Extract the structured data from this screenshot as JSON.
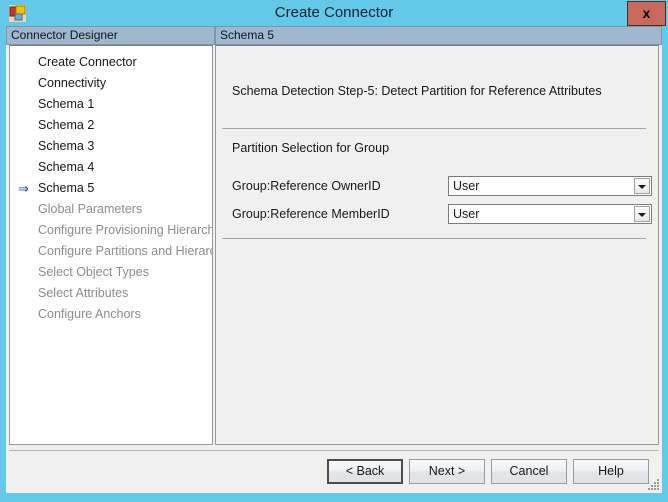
{
  "window": {
    "title": "Create Connector",
    "app_icon": "connector-app-icon",
    "close_label": "x"
  },
  "tabs": {
    "left": "Connector Designer",
    "right": "Schema 5"
  },
  "sidebar": {
    "items": [
      {
        "label": "Create Connector",
        "state": "enabled",
        "current": false
      },
      {
        "label": "Connectivity",
        "state": "enabled",
        "current": false
      },
      {
        "label": "Schema 1",
        "state": "enabled",
        "current": false
      },
      {
        "label": "Schema 2",
        "state": "enabled",
        "current": false
      },
      {
        "label": "Schema 3",
        "state": "enabled",
        "current": false
      },
      {
        "label": "Schema 4",
        "state": "enabled",
        "current": false
      },
      {
        "label": "Schema 5",
        "state": "enabled",
        "current": true,
        "marker": "⇒"
      },
      {
        "label": "Global Parameters",
        "state": "disabled",
        "current": false
      },
      {
        "label": "Configure Provisioning Hierarchy",
        "state": "disabled",
        "current": false
      },
      {
        "label": "Configure Partitions and Hierarchies",
        "state": "disabled",
        "current": false
      },
      {
        "label": "Select Object Types",
        "state": "disabled",
        "current": false
      },
      {
        "label": "Select Attributes",
        "state": "disabled",
        "current": false
      },
      {
        "label": "Configure Anchors",
        "state": "disabled",
        "current": false
      }
    ]
  },
  "content": {
    "step_heading": "Schema Detection Step-5: Detect Partition for Reference Attributes",
    "section_title": "Partition Selection for Group",
    "fields": [
      {
        "label": "Group:Reference OwnerID",
        "value": "User"
      },
      {
        "label": "Group:Reference MemberID",
        "value": "User"
      }
    ]
  },
  "footer": {
    "back": "<  Back",
    "next": "Next  >",
    "cancel": "Cancel",
    "help": "Help"
  },
  "colors": {
    "titlebar": "#64c8e8",
    "close_button": "#c9695e",
    "tab_header": "#9fb8cd",
    "panel_bg": "#f0f0f0",
    "sidebar_bg": "#ffffff",
    "disabled_text": "#8c8c8c",
    "arrow_marker": "#1344a8"
  }
}
